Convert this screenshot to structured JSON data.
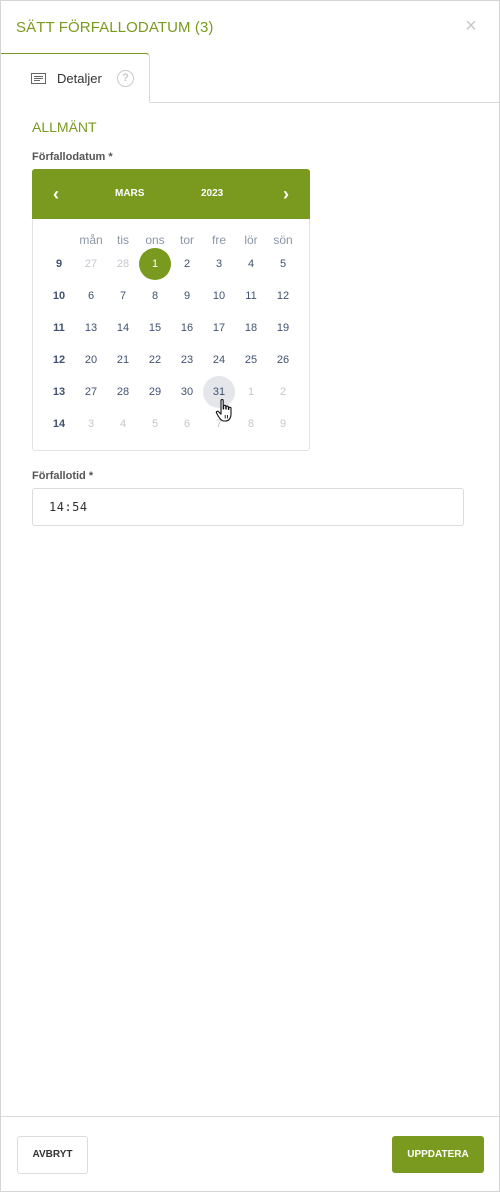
{
  "dialog": {
    "title": "SÄTT FÖRFALLODATUM (3)",
    "close_symbol": "×"
  },
  "tabs": [
    {
      "label": "Detaljer",
      "icon": "list-icon",
      "help_symbol": "?"
    }
  ],
  "section": {
    "title": "ALLMÄNT"
  },
  "due_date": {
    "label": "Förfallodatum *",
    "calendar": {
      "prev_symbol": "‹",
      "next_symbol": "›",
      "month": "MARS",
      "year": "2023",
      "weekdays": [
        "mån",
        "tis",
        "ons",
        "tor",
        "fre",
        "lör",
        "sön"
      ],
      "weeks": [
        {
          "week": "9",
          "days": [
            {
              "d": "27",
              "m": true
            },
            {
              "d": "28",
              "m": true
            },
            {
              "d": "1",
              "sel": true
            },
            {
              "d": "2"
            },
            {
              "d": "3"
            },
            {
              "d": "4"
            },
            {
              "d": "5"
            }
          ]
        },
        {
          "week": "10",
          "days": [
            {
              "d": "6"
            },
            {
              "d": "7"
            },
            {
              "d": "8"
            },
            {
              "d": "9"
            },
            {
              "d": "10"
            },
            {
              "d": "11"
            },
            {
              "d": "12"
            }
          ]
        },
        {
          "week": "11",
          "days": [
            {
              "d": "13"
            },
            {
              "d": "14"
            },
            {
              "d": "15"
            },
            {
              "d": "16"
            },
            {
              "d": "17"
            },
            {
              "d": "18"
            },
            {
              "d": "19"
            }
          ]
        },
        {
          "week": "12",
          "days": [
            {
              "d": "20"
            },
            {
              "d": "21"
            },
            {
              "d": "22"
            },
            {
              "d": "23"
            },
            {
              "d": "24"
            },
            {
              "d": "25"
            },
            {
              "d": "26"
            }
          ]
        },
        {
          "week": "13",
          "days": [
            {
              "d": "27"
            },
            {
              "d": "28"
            },
            {
              "d": "29"
            },
            {
              "d": "30"
            },
            {
              "d": "31",
              "hover": true
            },
            {
              "d": "1",
              "m": true
            },
            {
              "d": "2",
              "m": true
            }
          ]
        },
        {
          "week": "14",
          "days": [
            {
              "d": "3",
              "m": true
            },
            {
              "d": "4",
              "m": true
            },
            {
              "d": "5",
              "m": true
            },
            {
              "d": "6",
              "m": true
            },
            {
              "d": "7",
              "m": true
            },
            {
              "d": "8",
              "m": true
            },
            {
              "d": "9",
              "m": true
            }
          ]
        }
      ]
    }
  },
  "due_time": {
    "label": "Förfallotid *",
    "value": "14:54"
  },
  "footer": {
    "cancel_label": "AVBRYT",
    "update_label": "UPPDATERA"
  },
  "colors": {
    "accent": "#7a9a1f",
    "day_text": "#3f5272",
    "muted_day": "#c3c7ce",
    "hover_day": "#e4e6ea"
  }
}
